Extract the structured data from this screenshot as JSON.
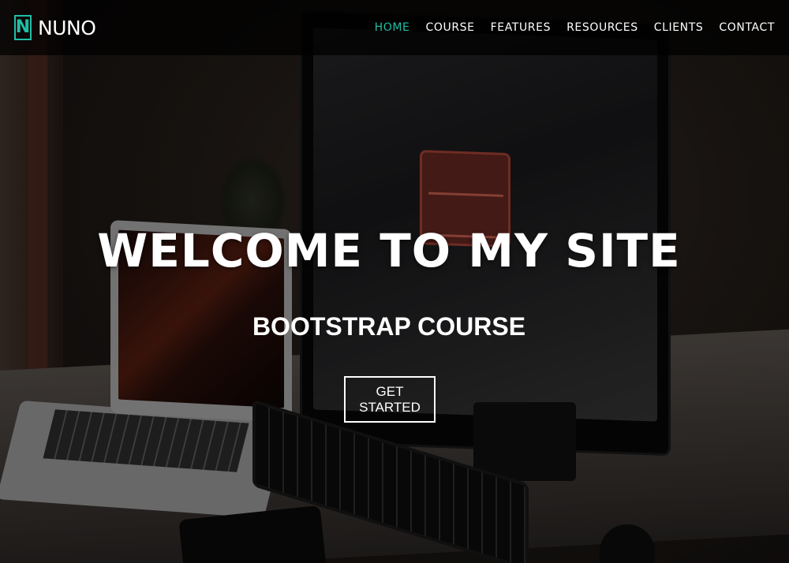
{
  "brand": {
    "logo_letter": "N",
    "name": "NUNO",
    "accent_color": "#1fbfa5"
  },
  "nav": {
    "items": [
      {
        "label": "HOME",
        "active": true
      },
      {
        "label": "COURSE",
        "active": false
      },
      {
        "label": "FEATURES",
        "active": false
      },
      {
        "label": "RESOURCES",
        "active": false
      },
      {
        "label": "CLIENTS",
        "active": false
      },
      {
        "label": "CONTACT",
        "active": false
      }
    ]
  },
  "hero": {
    "title": "WELCOME TO MY SITE",
    "subtitle": "BOOTSTRAP COURSE",
    "button_label": "GET STARTED"
  }
}
